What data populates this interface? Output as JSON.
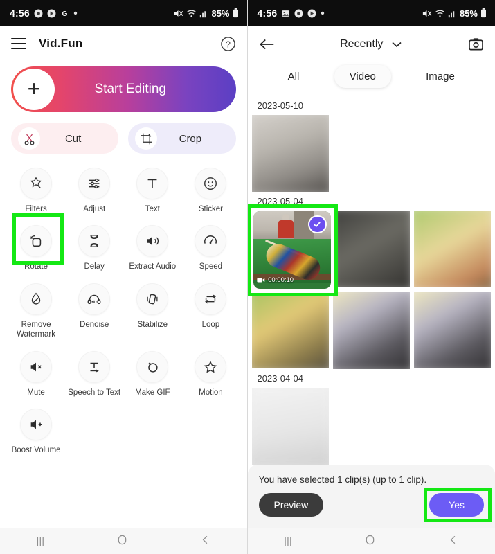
{
  "left_phone": {
    "status_bar": {
      "time": "4:56",
      "battery": "85%",
      "icons": [
        "chrome-icon",
        "play-store-icon",
        "google-g-icon",
        "dot-icon"
      ],
      "right_icons": [
        "mute-icon",
        "wifi-icon",
        "signal-icon",
        "battery-icon"
      ]
    },
    "header": {
      "menu_icon": "hamburger-icon",
      "title": "Vid.Fun",
      "help_icon": "help-circle-icon"
    },
    "start_button": {
      "label": "Start Editing",
      "plus": "+",
      "gradient_from": "#f2504b",
      "gradient_to": "#5b3fc4"
    },
    "pills": [
      {
        "label": "Cut",
        "icon": "scissors-icon",
        "bg": "#fdeef0"
      },
      {
        "label": "Crop",
        "icon": "crop-icon",
        "bg": "#eeecfa"
      }
    ],
    "tools": [
      {
        "label": "Filters",
        "icon": "magic-wand-icon"
      },
      {
        "label": "Adjust",
        "icon": "sliders-icon"
      },
      {
        "label": "Text",
        "icon": "text-icon"
      },
      {
        "label": "Sticker",
        "icon": "smiley-icon"
      },
      {
        "label": "Rotate",
        "icon": "rotate-icon",
        "highlighted": true
      },
      {
        "label": "Delay",
        "icon": "hourglass-icon"
      },
      {
        "label": "Extract Audio",
        "icon": "speaker-icon"
      },
      {
        "label": "Speed",
        "icon": "speedometer-icon"
      },
      {
        "label": "Remove Watermark",
        "icon": "droplet-icon"
      },
      {
        "label": "Denoise",
        "icon": "headphones-icon"
      },
      {
        "label": "Stabilize",
        "icon": "stabilize-icon"
      },
      {
        "label": "Loop",
        "icon": "loop-icon"
      },
      {
        "label": "Mute",
        "icon": "mute-speaker-icon"
      },
      {
        "label": "Speech to Text",
        "icon": "speech-text-icon"
      },
      {
        "label": "Make GIF",
        "icon": "gif-icon"
      },
      {
        "label": "Motion",
        "icon": "star-motion-icon"
      },
      {
        "label": "Boost Volume",
        "icon": "volume-plus-icon"
      }
    ],
    "nav": [
      "recents-icon",
      "home-icon",
      "back-icon"
    ]
  },
  "right_phone": {
    "status_bar": {
      "time": "4:56",
      "battery": "85%",
      "icons": [
        "gallery-icon",
        "chrome-icon",
        "play-store-icon",
        "dot-icon"
      ],
      "right_icons": [
        "mute-icon",
        "wifi-icon",
        "signal-icon",
        "battery-icon"
      ]
    },
    "header": {
      "back_icon": "back-arrow-icon",
      "album": "Recently",
      "chevron": "chevron-down-icon",
      "camera_icon": "camera-icon"
    },
    "tabs": [
      {
        "label": "All",
        "active": false
      },
      {
        "label": "Video",
        "active": true
      },
      {
        "label": "Image",
        "active": false
      }
    ],
    "groups": [
      {
        "date": "2023-05-10",
        "items": [
          {
            "kind": "blur",
            "style": "bl-a"
          }
        ]
      },
      {
        "date": "2023-05-04",
        "items": [
          {
            "kind": "video",
            "duration": "00:00:10",
            "selected": true,
            "icon": "video-camera-icon",
            "check_icon": "check-icon"
          },
          {
            "kind": "blur",
            "style": "bl-b"
          },
          {
            "kind": "blur",
            "style": "bl-c"
          },
          {
            "kind": "blur",
            "style": "bl-d"
          },
          {
            "kind": "blur",
            "style": "bl-e"
          },
          {
            "kind": "blur",
            "style": "bl-f"
          }
        ]
      },
      {
        "date": "2023-04-04",
        "items": [
          {
            "kind": "blur",
            "style": "bl-g"
          }
        ]
      }
    ],
    "sheet": {
      "message": "You have selected 1 clip(s) (up to 1 clip).",
      "preview_label": "Preview",
      "yes_label": "Yes",
      "yes_color": "#6c5cf5",
      "yes_highlighted": true
    },
    "nav": [
      "recents-icon",
      "home-icon",
      "back-icon"
    ]
  },
  "annotations": {
    "highlight_color": "#14e814",
    "boxes": [
      {
        "target": "rotate-tool",
        "phone": "left"
      },
      {
        "target": "selected-video-thumbnail",
        "phone": "right"
      },
      {
        "target": "yes-button",
        "phone": "right"
      }
    ]
  }
}
